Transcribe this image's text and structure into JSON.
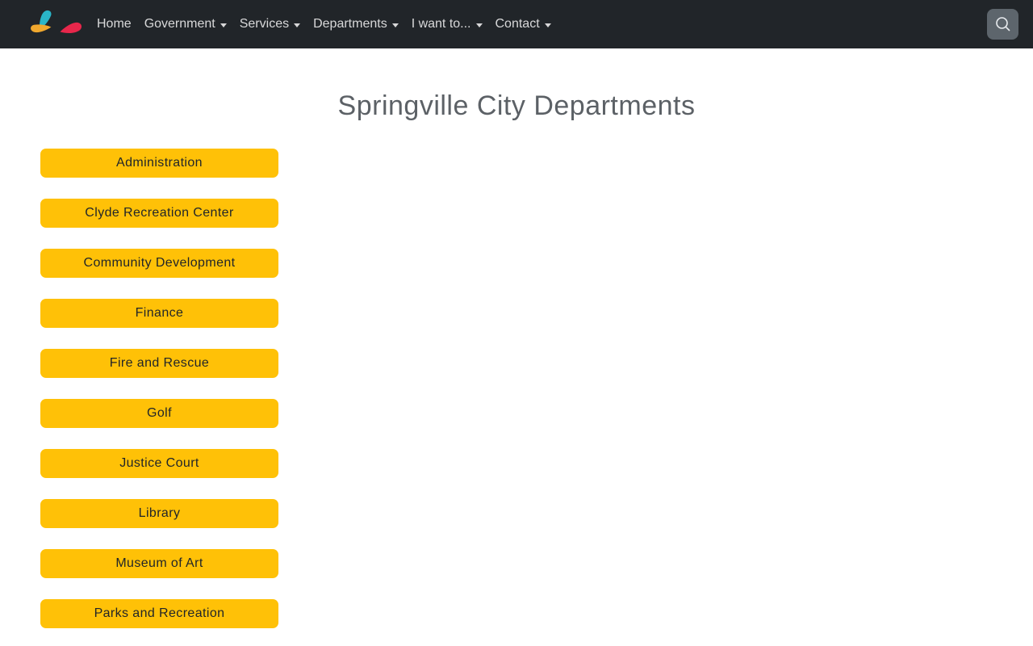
{
  "navbar": {
    "items": [
      {
        "label": "Home",
        "dropdown": false
      },
      {
        "label": "Government",
        "dropdown": true
      },
      {
        "label": "Services",
        "dropdown": true
      },
      {
        "label": "Departments",
        "dropdown": true
      },
      {
        "label": "I want to...",
        "dropdown": true
      },
      {
        "label": "Contact",
        "dropdown": true
      }
    ],
    "search": {
      "icon": "magnifier"
    }
  },
  "page": {
    "title": "Springville City Departments"
  },
  "departments": [
    "Administration",
    "Clyde Recreation Center",
    "Community Development",
    "Finance",
    "Fire and Rescue",
    "Golf",
    "Justice Court",
    "Library",
    "Museum of Art",
    "Parks and Recreation"
  ],
  "colors": {
    "navbar_bg": "#212529",
    "nav_link": "#d2d5d8",
    "search_button_bg": "#5d656c",
    "button_bg": "#ffc107",
    "button_text": "#212529",
    "title_text": "#5c6166",
    "logo_teal": "#2ab5c8",
    "logo_orange": "#f0a82e",
    "logo_red": "#e8274b"
  }
}
